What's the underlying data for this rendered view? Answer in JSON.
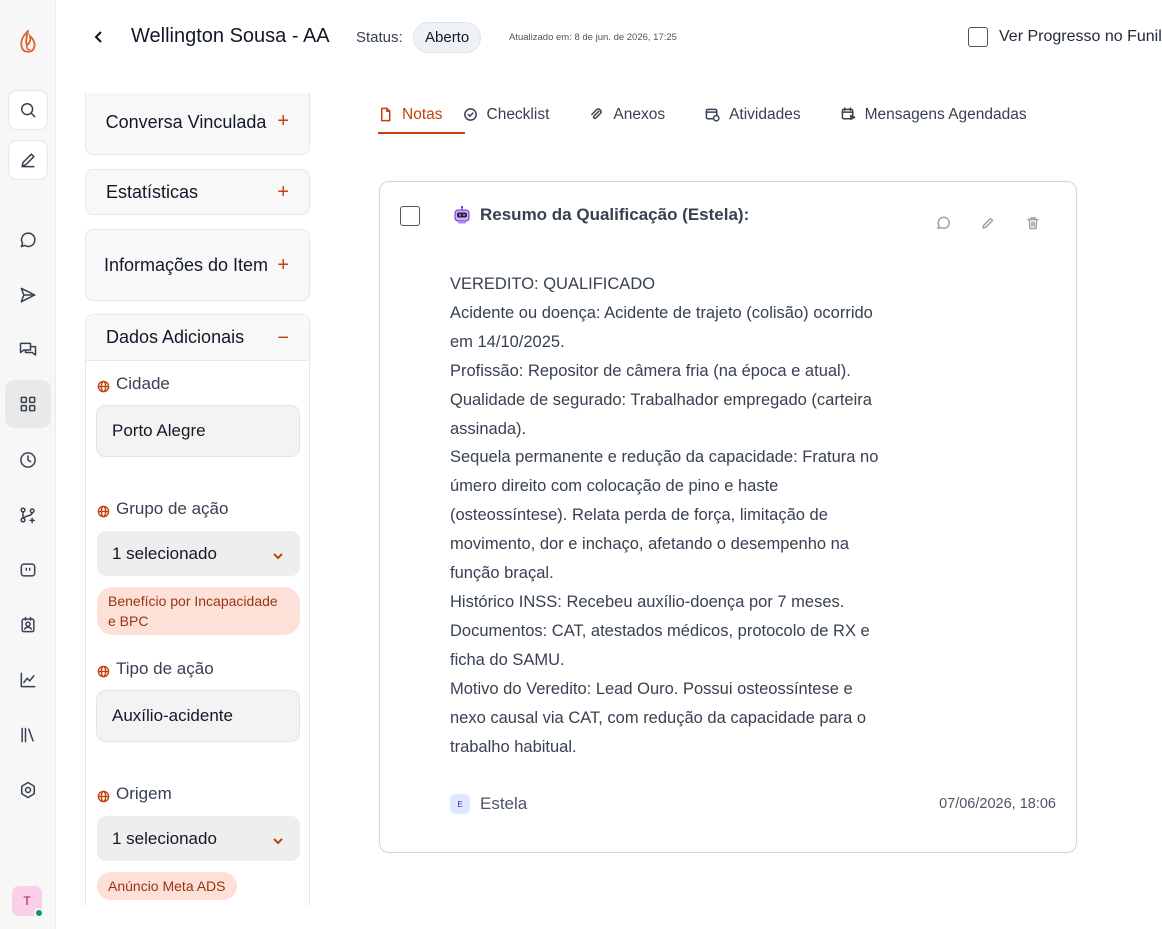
{
  "header": {
    "title": "Wellington Sousa - AA",
    "status_label": "Status:",
    "status_value": "Aberto",
    "updated": "Atualizado em: 8 de jun. de 2026, 17:25",
    "funnel_label": "Ver Progresso no Funil"
  },
  "sidebar": {
    "icons": [
      "logo-icon",
      "search-icon",
      "edit-icon",
      "chat-icon",
      "send-icon",
      "messages-icon",
      "grid-icon",
      "clock-icon",
      "flow-icon",
      "quote-icon",
      "contact-icon",
      "chart-icon",
      "library-icon",
      "settings-icon"
    ],
    "active": "grid-icon",
    "avatar_initial": "T",
    "avatar_online_color": "#059669"
  },
  "panel": {
    "cards": {
      "conversa": {
        "title": "Conversa Vinculada",
        "toggle": "+"
      },
      "estatisticas": {
        "title": "Estatísticas",
        "toggle": "+"
      },
      "informacoes": {
        "title": "Informações do Item",
        "toggle": "+"
      },
      "dados": {
        "title": "Dados Adicionais",
        "toggle": "−"
      }
    },
    "fields": {
      "cidade": {
        "label": "Cidade",
        "value": "Porto Alegre"
      },
      "grupo": {
        "label": "Grupo de ação",
        "value": "1 selecionado",
        "tag": "Benefício por Incapacidade e BPC"
      },
      "tipo": {
        "label": "Tipo de ação",
        "value": "Auxílio-acidente"
      },
      "origem": {
        "label": "Origem",
        "value": "1 selecionado",
        "tag": "Anúncio Meta ADS"
      }
    }
  },
  "tabs": [
    {
      "label": "Notas",
      "icon": "file-icon",
      "active": true
    },
    {
      "label": "Checklist",
      "icon": "check-circle-icon"
    },
    {
      "label": "Anexos",
      "icon": "paperclip-icon"
    },
    {
      "label": "Atividades",
      "icon": "calendar-clock-icon"
    },
    {
      "label": "Mensagens Agendadas",
      "icon": "calendar-schedule-icon"
    }
  ],
  "note": {
    "title": "Resumo da Qualificação (Estela):",
    "lines": [
      "VEREDITO: QUALIFICADO",
      "Acidente ou doença: Acidente de trajeto (colisão) ocorrido",
      "em 14/10/2025.",
      "Profissão: Repositor de câmera fria (na época e atual).",
      "Qualidade de segurado: Trabalhador empregado (carteira",
      "assinada).",
      "Sequela permanente e redução da capacidade: Fratura no",
      "úmero direito com colocação de pino e haste",
      "(osteossíntese). Relata perda de força, limitação de",
      "movimento, dor e inchaço, afetando o desempenho na",
      "função braçal.",
      "Histórico INSS: Recebeu auxílio-doença por 7 meses.",
      "Documentos: CAT, atestados médicos, protocolo de RX e",
      "ficha do SAMU.",
      "Motivo do Veredito: Lead Ouro. Possui osteossíntese e",
      "nexo causal via CAT, com redução da capacidade para o",
      "trabalho habitual."
    ],
    "author_initial": "E",
    "author": "Estela",
    "date": "07/06/2026, 18:06"
  },
  "colors": {
    "accent": "#c2410c",
    "tag_bg": "#fde0d7"
  }
}
